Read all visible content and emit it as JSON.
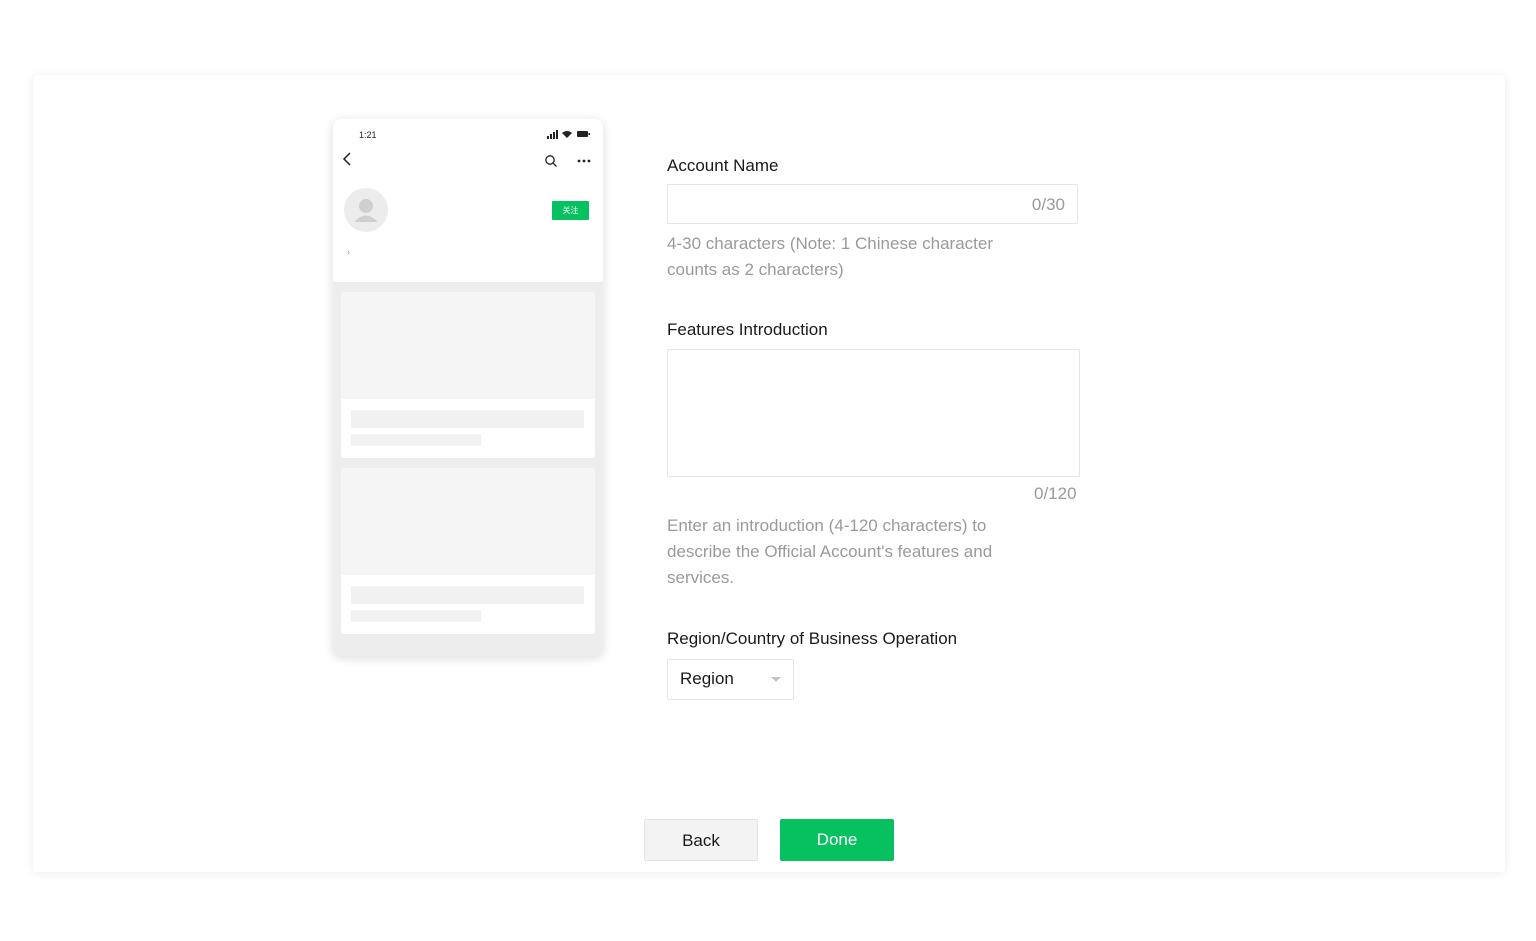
{
  "preview": {
    "status_time": "1:21",
    "follow_label": "关注"
  },
  "form": {
    "account_name": {
      "label": "Account Name",
      "value": "",
      "counter": "0/30",
      "hint": "4-30 characters (Note: 1 Chinese character counts as 2 characters)"
    },
    "features": {
      "label": "Features Introduction",
      "value": "",
      "counter": "0/120",
      "hint": "Enter an introduction (4-120 characters) to describe the Official Account's features and services."
    },
    "region": {
      "label": "Region/Country of Business Operation",
      "selected": "Region"
    }
  },
  "actions": {
    "back_label": "Back",
    "done_label": "Done"
  },
  "colors": {
    "accent": "#07c160",
    "hint_text": "#9a9a9a",
    "border": "#e5e5e5"
  }
}
